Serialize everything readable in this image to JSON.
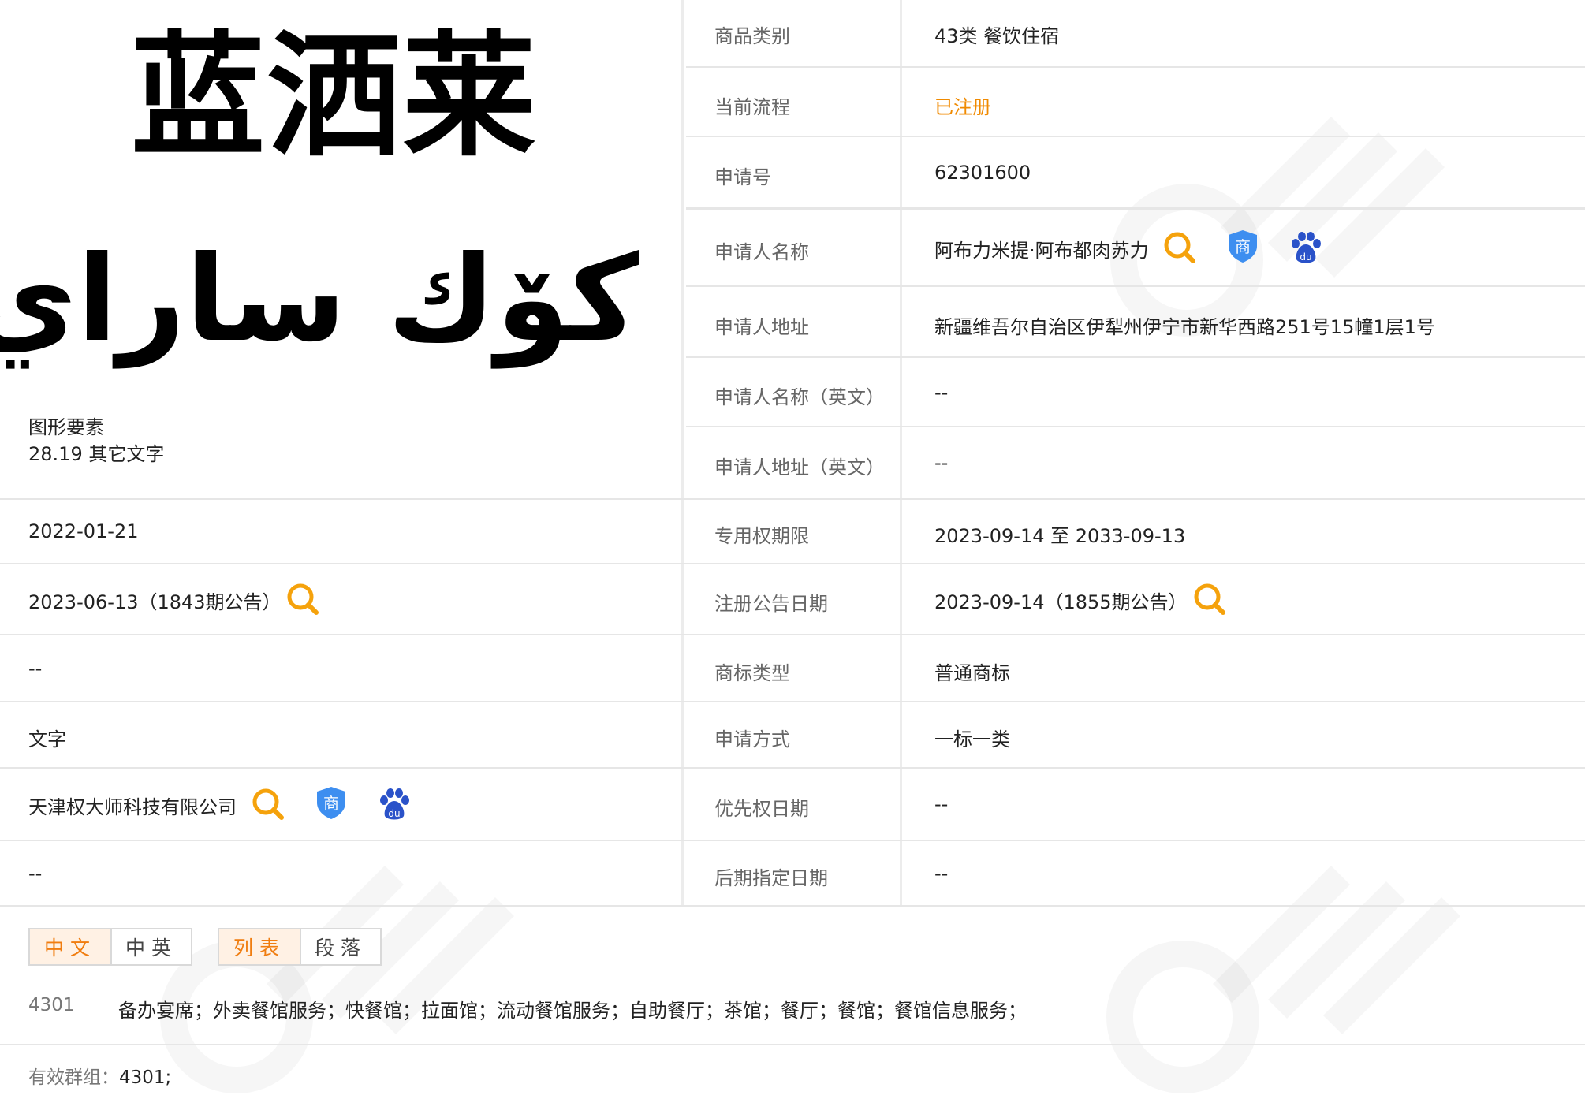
{
  "trademark": {
    "name_cn": "蓝洒莱",
    "name_ug": "كۆك ساراي",
    "figurative_label": "图形要素",
    "figurative_value": "28.19 其它文字"
  },
  "left_rows": {
    "application_date": "2022-01-21",
    "preliminary_announcement": "2023-06-13（1843期公告）",
    "international_reg_date": "--",
    "trademark_form": "文字",
    "agency": "天津权大师科技有限公司",
    "row_last": "--"
  },
  "right_rows": [
    {
      "label": "商品类别",
      "value": "43类 餐饮住宿"
    },
    {
      "label": "当前流程",
      "value": "已注册"
    },
    {
      "label": "申请号",
      "value": "62301600"
    },
    {
      "label": "申请人名称",
      "value": "阿布力米提·阿布都肉苏力"
    },
    {
      "label": "申请人地址",
      "value": "新疆维吾尔自治区伊犁州伊宁市新华西路251号15幢1层1号"
    },
    {
      "label": "申请人名称（英文）",
      "value": "--"
    },
    {
      "label": "申请人地址（英文）",
      "value": "--"
    },
    {
      "label": "专用权期限",
      "value": "2023-09-14 至 2033-09-13"
    },
    {
      "label": "注册公告日期",
      "value": "2023-09-14（1855期公告）"
    },
    {
      "label": "商标类型",
      "value": "普通商标"
    },
    {
      "label": "申请方式",
      "value": "一标一类"
    },
    {
      "label": "优先权日期",
      "value": "--"
    },
    {
      "label": "后期指定日期",
      "value": "--"
    }
  ],
  "tabs": {
    "lang": [
      {
        "label": "中文",
        "active": true
      },
      {
        "label": "中英",
        "active": false
      }
    ],
    "view": [
      {
        "label": "列表",
        "active": true
      },
      {
        "label": "段落",
        "active": false
      }
    ]
  },
  "goods": {
    "code": "4301",
    "items": "备办宴席；外卖餐馆服务；快餐馆；拉面馆；流动餐馆服务；自助餐厅；茶馆；餐厅；餐馆；餐馆信息服务；"
  },
  "group": {
    "label": "有效群组：",
    "value": "4301;"
  },
  "icons": {
    "search": "search-icon",
    "trademark_shield": "trademark-shield-icon",
    "baidu": "baidu-paw-icon"
  },
  "colors": {
    "accent_orange": "#f08a00",
    "shield_blue": "#3d8ef0",
    "baidu_blue": "#2a52c9"
  }
}
